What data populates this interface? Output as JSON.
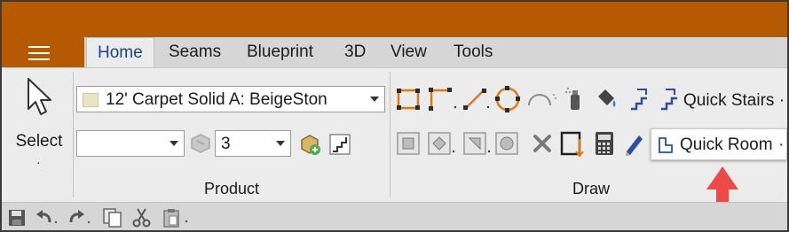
{
  "colors": {
    "accent": "#b55a00",
    "active_tab_text": "#1f3f8a",
    "callout_arrow": "#ee4848",
    "icon_orange": "#d97a16",
    "icon_blue": "#2b4f9e"
  },
  "tabs": [
    {
      "label": "Home",
      "active": true
    },
    {
      "label": "Seams",
      "active": false
    },
    {
      "label": "Blueprint",
      "active": false
    },
    {
      "label": "3D",
      "active": false
    },
    {
      "label": "View",
      "active": false
    },
    {
      "label": "Tools",
      "active": false
    }
  ],
  "select_tool": {
    "label": "Select",
    "dot": "·",
    "icon": "cursor-arrow-icon"
  },
  "product": {
    "group_label": "Product",
    "material_value": "12' Carpet Solid A: BeigeSton",
    "secondary_value": "",
    "quantity_value": "3",
    "icons": [
      "paint-disabled-icon",
      "product-add-icon",
      "stair-grid-icon"
    ]
  },
  "draw": {
    "group_label": "Draw",
    "quick_stairs_label": "Quick Stairs",
    "quick_room_label": "Quick Room",
    "row1_icons": [
      "rectangle-icon",
      "corner-line-icon",
      "line-icon",
      "circle-icon",
      "arc-icon",
      "spray-icon",
      "fill-bucket-icon",
      "stairs-icon",
      "quick-stairs-icon"
    ],
    "row2_icons": [
      "square-shape-icon",
      "diamond-shape-icon",
      "triangle-shape-icon",
      "circle-shape-icon",
      "delete-x-icon",
      "resize-corner-icon",
      "calculator-icon",
      "pencil-icon",
      "quick-room-icon"
    ]
  },
  "quick_access": {
    "icons": [
      "save-icon",
      "undo-icon",
      "redo-icon",
      "copy-icon",
      "cut-icon",
      "paste-icon"
    ]
  }
}
